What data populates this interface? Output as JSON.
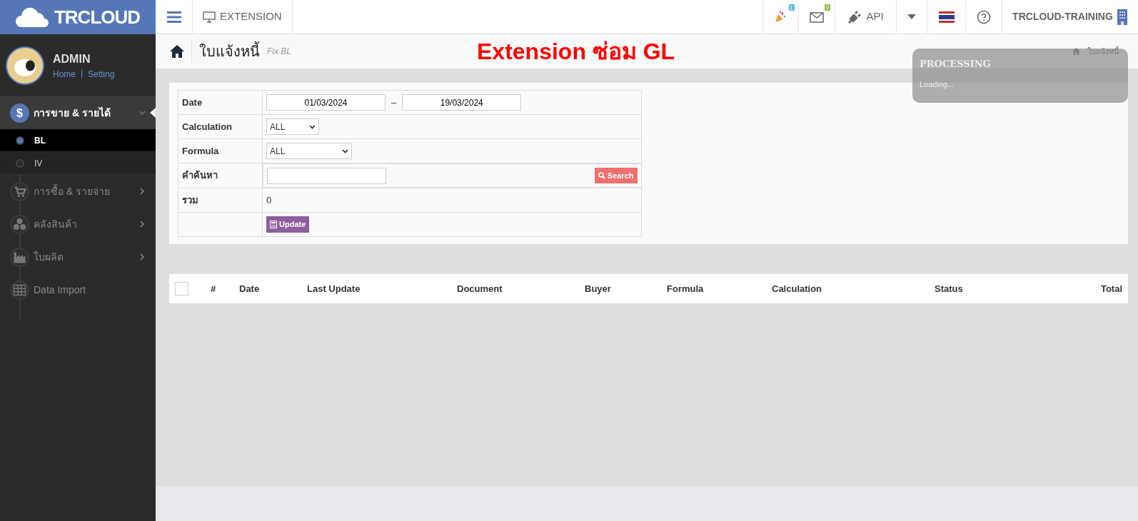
{
  "brand": {
    "text": "TRCLOUD"
  },
  "topbar": {
    "extension": "EXTENSION",
    "notifications": [
      {
        "badge": "1",
        "color": "#5bc0de"
      },
      {
        "badge": "0",
        "color": "#8cc152"
      }
    ],
    "api": "API",
    "company": "TRCLOUD-TRAINING"
  },
  "user": {
    "name": "ADMIN",
    "links": [
      "Home",
      "Setting"
    ]
  },
  "sidebar": {
    "items": [
      {
        "label": "การขาย & รายได้",
        "icon_text": "$",
        "expanded": true,
        "children": [
          {
            "label": "BL",
            "selected": true
          },
          {
            "label": "IV",
            "selected": false
          }
        ]
      },
      {
        "label": "การซื้อ & รายจ่าย",
        "expanded": false
      },
      {
        "label": "คลังสินค้า",
        "expanded": false
      },
      {
        "label": "ใบผลิต",
        "expanded": false
      },
      {
        "label": "Data Import"
      }
    ]
  },
  "page": {
    "title": "ใบแจ้งหนี้",
    "subtitle": "Fix BL",
    "annotation": "Extension ซ่อม GL",
    "breadcrumb": "ใบแจ้งหนี้"
  },
  "processing": {
    "title": "PROCESSING",
    "message": "Loading..."
  },
  "filter": {
    "rows": [
      {
        "kind": "daterange",
        "label": "Date",
        "from": "01/03/2024",
        "separator": "–",
        "to": "19/03/2024"
      },
      {
        "kind": "select",
        "label": "Calculation",
        "value": "ALL"
      },
      {
        "kind": "select",
        "label": "Formula",
        "value": "ALL"
      },
      {
        "kind": "search",
        "label": "คำค้นหา",
        "button": "Search"
      },
      {
        "kind": "text",
        "label": "รวม",
        "value": "0"
      },
      {
        "kind": "action",
        "button": "Update"
      }
    ]
  },
  "table": {
    "select_all": {
      "checked": false
    },
    "columns": [
      "#",
      "Date",
      "Last Update",
      "Document",
      "Buyer",
      "Formula",
      "Calculation",
      "Status",
      "Total"
    ]
  }
}
